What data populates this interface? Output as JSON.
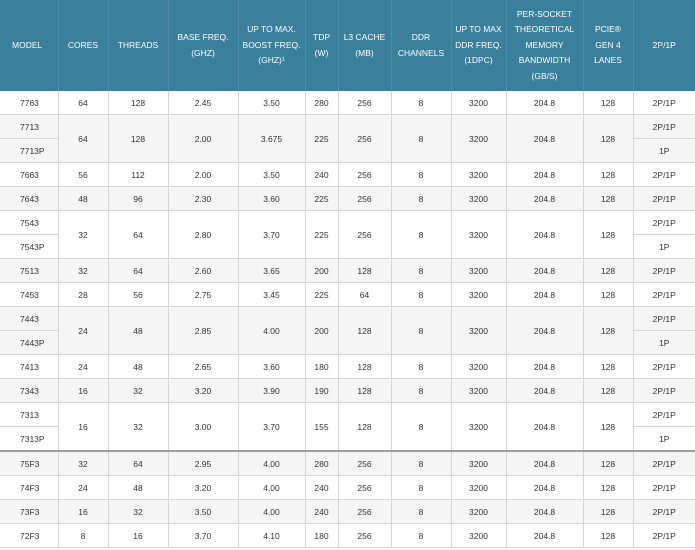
{
  "headers": [
    "MODEL",
    "CORES",
    "THREADS",
    "BASE FREQ. (GHZ)",
    "UP TO MAX. BOOST FREQ. (GHZ)¹",
    "TDP (W)",
    "L3 CACHE (MB)",
    "DDR CHANNELS",
    "UP TO MAX DDR FREQ. (1DPC)",
    "PER-SOCKET THEORETICAL MEMORY BANDWIDTH (GB/S)",
    "PCIE® GEN 4 LANES",
    "2P/1P"
  ],
  "rows": [
    {
      "models": [
        "7763"
      ],
      "cores": "64",
      "threads": "128",
      "base": "2.45",
      "boost": "3.50",
      "tdp": "280",
      "l3": "256",
      "ddr": "8",
      "ddrfreq": "3200",
      "bw": "204.8",
      "pcie": "128",
      "sockets": [
        "2P/1P"
      ]
    },
    {
      "models": [
        "7713",
        "7713P"
      ],
      "cores": "64",
      "threads": "128",
      "base": "2.00",
      "boost": "3.675",
      "tdp": "225",
      "l3": "256",
      "ddr": "8",
      "ddrfreq": "3200",
      "bw": "204.8",
      "pcie": "128",
      "sockets": [
        "2P/1P",
        "1P"
      ]
    },
    {
      "models": [
        "7663"
      ],
      "cores": "56",
      "threads": "112",
      "base": "2.00",
      "boost": "3.50",
      "tdp": "240",
      "l3": "256",
      "ddr": "8",
      "ddrfreq": "3200",
      "bw": "204.8",
      "pcie": "128",
      "sockets": [
        "2P/1P"
      ]
    },
    {
      "models": [
        "7643"
      ],
      "cores": "48",
      "threads": "96",
      "base": "2.30",
      "boost": "3.60",
      "tdp": "225",
      "l3": "256",
      "ddr": "8",
      "ddrfreq": "3200",
      "bw": "204.8",
      "pcie": "128",
      "sockets": [
        "2P/1P"
      ]
    },
    {
      "models": [
        "7543",
        "7543P"
      ],
      "cores": "32",
      "threads": "64",
      "base": "2.80",
      "boost": "3.70",
      "tdp": "225",
      "l3": "256",
      "ddr": "8",
      "ddrfreq": "3200",
      "bw": "204.8",
      "pcie": "128",
      "sockets": [
        "2P/1P",
        "1P"
      ]
    },
    {
      "models": [
        "7513"
      ],
      "cores": "32",
      "threads": "64",
      "base": "2.60",
      "boost": "3.65",
      "tdp": "200",
      "l3": "128",
      "ddr": "8",
      "ddrfreq": "3200",
      "bw": "204.8",
      "pcie": "128",
      "sockets": [
        "2P/1P"
      ]
    },
    {
      "models": [
        "7453"
      ],
      "cores": "28",
      "threads": "56",
      "base": "2.75",
      "boost": "3.45",
      "tdp": "225",
      "l3": "64",
      "ddr": "8",
      "ddrfreq": "3200",
      "bw": "204.8",
      "pcie": "128",
      "sockets": [
        "2P/1P"
      ]
    },
    {
      "models": [
        "7443",
        "7443P"
      ],
      "cores": "24",
      "threads": "48",
      "base": "2.85",
      "boost": "4.00",
      "tdp": "200",
      "l3": "128",
      "ddr": "8",
      "ddrfreq": "3200",
      "bw": "204.8",
      "pcie": "128",
      "sockets": [
        "2P/1P",
        "1P"
      ]
    },
    {
      "models": [
        "7413"
      ],
      "cores": "24",
      "threads": "48",
      "base": "2.65",
      "boost": "3.60",
      "tdp": "180",
      "l3": "128",
      "ddr": "8",
      "ddrfreq": "3200",
      "bw": "204.8",
      "pcie": "128",
      "sockets": [
        "2P/1P"
      ]
    },
    {
      "models": [
        "7343"
      ],
      "cores": "16",
      "threads": "32",
      "base": "3.20",
      "boost": "3.90",
      "tdp": "190",
      "l3": "128",
      "ddr": "8",
      "ddrfreq": "3200",
      "bw": "204.8",
      "pcie": "128",
      "sockets": [
        "2P/1P"
      ]
    },
    {
      "models": [
        "7313",
        "7313P"
      ],
      "cores": "16",
      "threads": "32",
      "base": "3.00",
      "boost": "3.70",
      "tdp": "155",
      "l3": "128",
      "ddr": "8",
      "ddrfreq": "3200",
      "bw": "204.8",
      "pcie": "128",
      "sockets": [
        "2P/1P",
        "1P"
      ]
    },
    {
      "models": [
        "75F3"
      ],
      "cores": "32",
      "threads": "64",
      "base": "2.95",
      "boost": "4.00",
      "tdp": "280",
      "l3": "256",
      "ddr": "8",
      "ddrfreq": "3200",
      "bw": "204.8",
      "pcie": "128",
      "sockets": [
        "2P/1P"
      ],
      "heavy": true
    },
    {
      "models": [
        "74F3"
      ],
      "cores": "24",
      "threads": "48",
      "base": "3.20",
      "boost": "4.00",
      "tdp": "240",
      "l3": "256",
      "ddr": "8",
      "ddrfreq": "3200",
      "bw": "204.8",
      "pcie": "128",
      "sockets": [
        "2P/1P"
      ]
    },
    {
      "models": [
        "73F3"
      ],
      "cores": "16",
      "threads": "32",
      "base": "3.50",
      "boost": "4.00",
      "tdp": "240",
      "l3": "256",
      "ddr": "8",
      "ddrfreq": "3200",
      "bw": "204.8",
      "pcie": "128",
      "sockets": [
        "2P/1P"
      ]
    },
    {
      "models": [
        "72F3"
      ],
      "cores": "8",
      "threads": "16",
      "base": "3.70",
      "boost": "4.10",
      "tdp": "180",
      "l3": "256",
      "ddr": "8",
      "ddrfreq": "3200",
      "bw": "204.8",
      "pcie": "128",
      "sockets": [
        "2P/1P"
      ]
    }
  ],
  "colors": {
    "header_bg": "#3a7f9b",
    "header_text": "#ffffff",
    "row_alt": "#f5f5f5",
    "grid": "#d6d6d6"
  }
}
